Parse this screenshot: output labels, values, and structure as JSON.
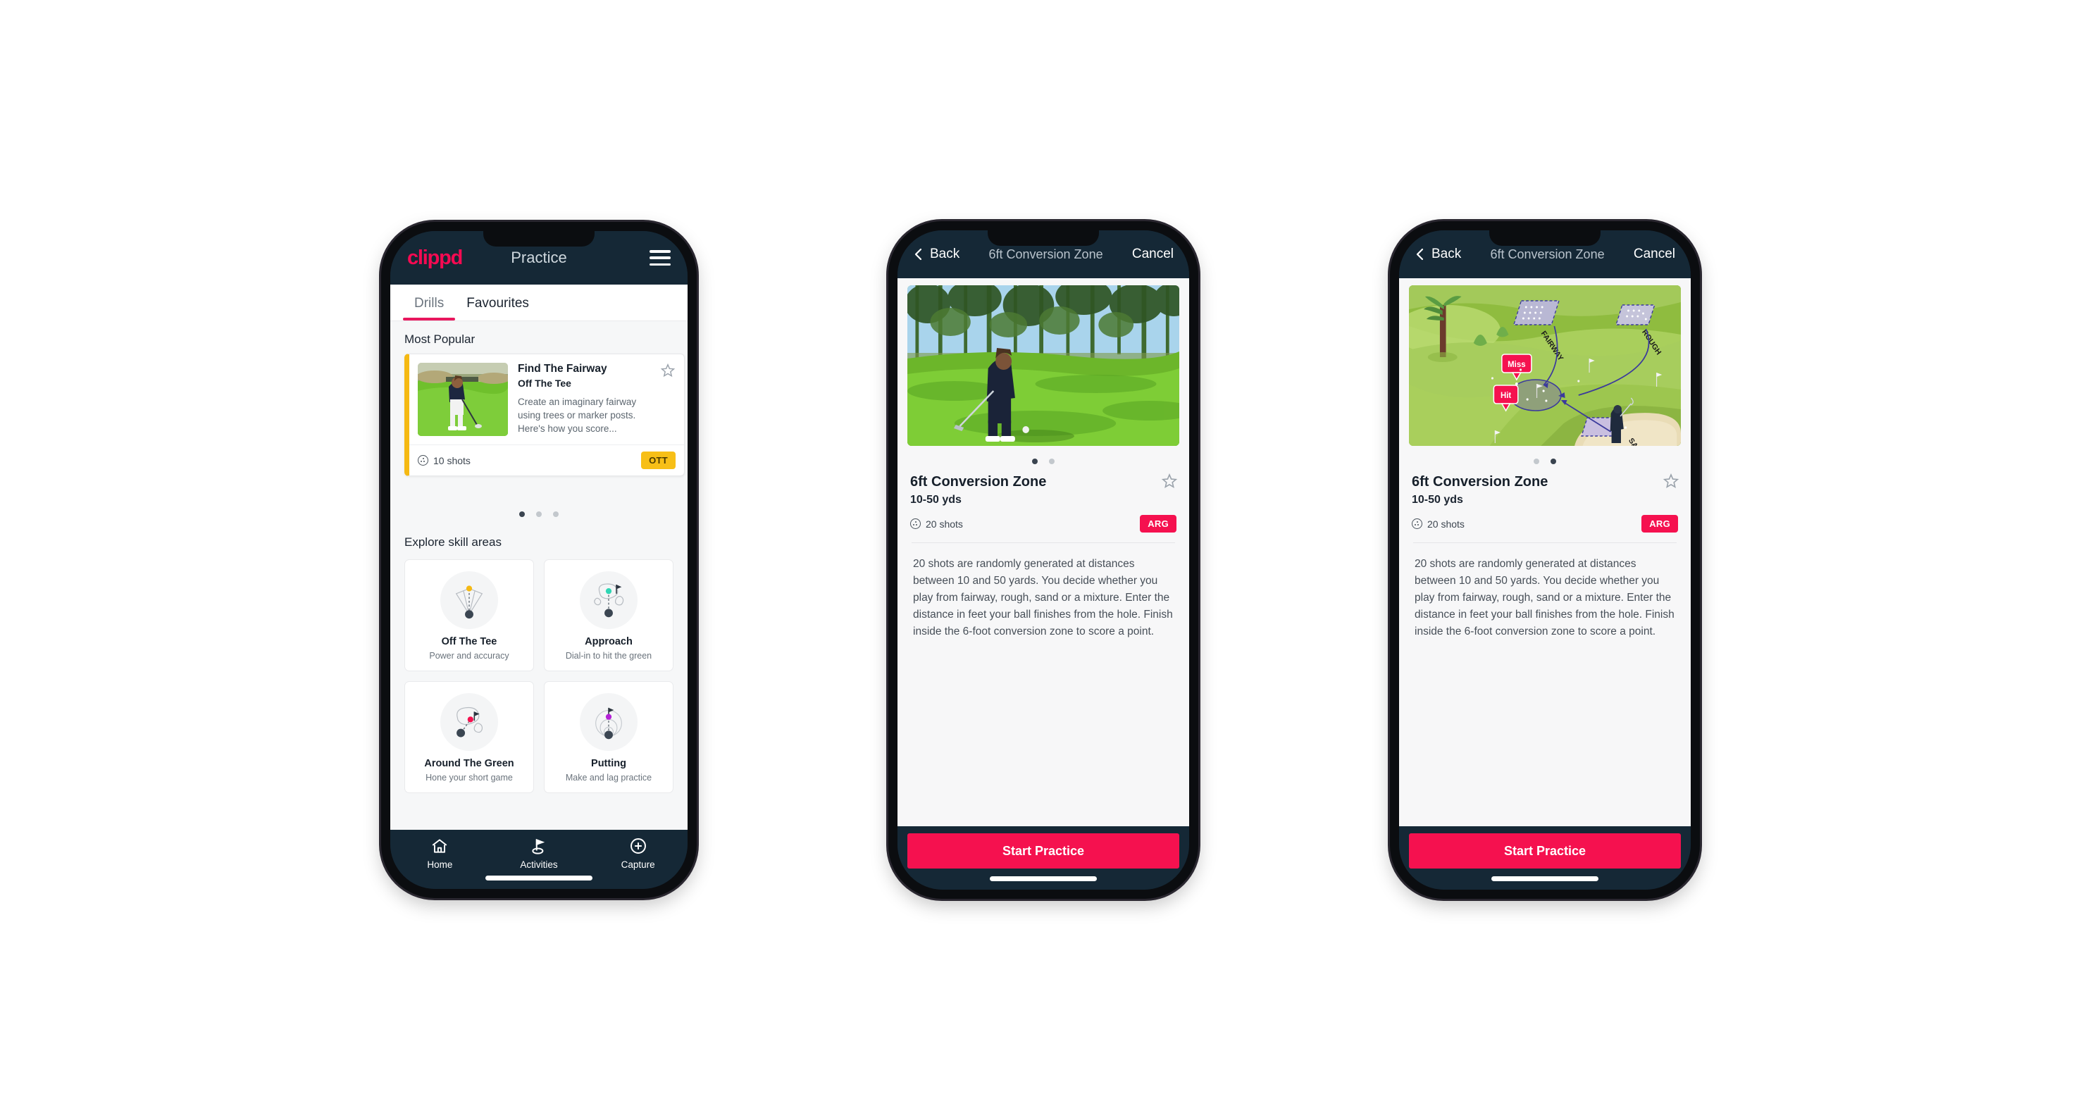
{
  "app": {
    "brand": "clippd",
    "title": "Practice",
    "menu_icon": "hamburger-icon"
  },
  "tabs": [
    {
      "label": "Drills",
      "active": true
    },
    {
      "label": "Favourites",
      "active": false
    }
  ],
  "sections": {
    "most_popular": "Most Popular",
    "explore": "Explore skill areas"
  },
  "drill_card": {
    "name": "Find The Fairway",
    "category": "Off The Tee",
    "description": "Create an imaginary fairway using trees or marker posts. Here's how you score...",
    "shots": "10 shots",
    "badge": "OTT",
    "accent": "#f5b913",
    "peek_accent": "#2fd6b4",
    "star_icon": "star-outline-icon",
    "shots_icon": "golf-ball-icon"
  },
  "carousel_dots": {
    "count": 3,
    "active_index": 0
  },
  "skill_areas": [
    {
      "name": "Off The Tee",
      "desc": "Power and accuracy",
      "icon": "tee-fan-icon",
      "dot_color": "#f5b913"
    },
    {
      "name": "Approach",
      "desc": "Dial-in to hit the green",
      "icon": "approach-icon",
      "dot_color": "#2fd6b4"
    },
    {
      "name": "Around The Green",
      "desc": "Hone your short game",
      "icon": "around-green-icon",
      "dot_color": "#f5114f"
    },
    {
      "name": "Putting",
      "desc": "Make and lag practice",
      "icon": "putting-icon",
      "dot_color": "#b421d6"
    }
  ],
  "bottom_nav": [
    {
      "label": "Home",
      "icon": "home-icon"
    },
    {
      "label": "Activities",
      "icon": "golf-flag-icon",
      "active": true
    },
    {
      "label": "Capture",
      "icon": "plus-circle-icon"
    }
  ],
  "detail": {
    "back": "Back",
    "title": "6ft Conversion Zone",
    "cancel": "Cancel",
    "back_icon": "chevron-left-icon",
    "heading": "6ft Conversion Zone",
    "distance": "10-50 yds",
    "shots": "20 shots",
    "badge": "ARG",
    "badge_color": "#f5114f",
    "star_icon": "star-outline-icon",
    "description": "20 shots are randomly generated at distances between 10 and 50 yards. You decide whether you play from fairway, rough, sand or a mixture. Enter the distance in feet your ball finishes from the hole. Finish inside the 6-foot conversion zone to score a point.",
    "start_button": "Start Practice",
    "media_dots": {
      "count": 2,
      "active_index_phone2": 0,
      "active_index_phone3": 1
    },
    "media_phone2": "golfer-chipping-photo",
    "media_phone3": "course-diagram-illustration"
  },
  "diagram": {
    "labels": {
      "fairway": "FAIRWAY",
      "rough": "ROUGH",
      "sand": "SAND"
    },
    "callouts": {
      "miss": "Miss",
      "hit": "Hit"
    },
    "callout_color": "#f5114f",
    "arrow_color": "#3b3a9c"
  },
  "theme": {
    "brand_pink": "#f50a52",
    "header_navy": "#152836",
    "page_bg": "#f6f7f8",
    "canvas_bg": "#ffffff"
  }
}
